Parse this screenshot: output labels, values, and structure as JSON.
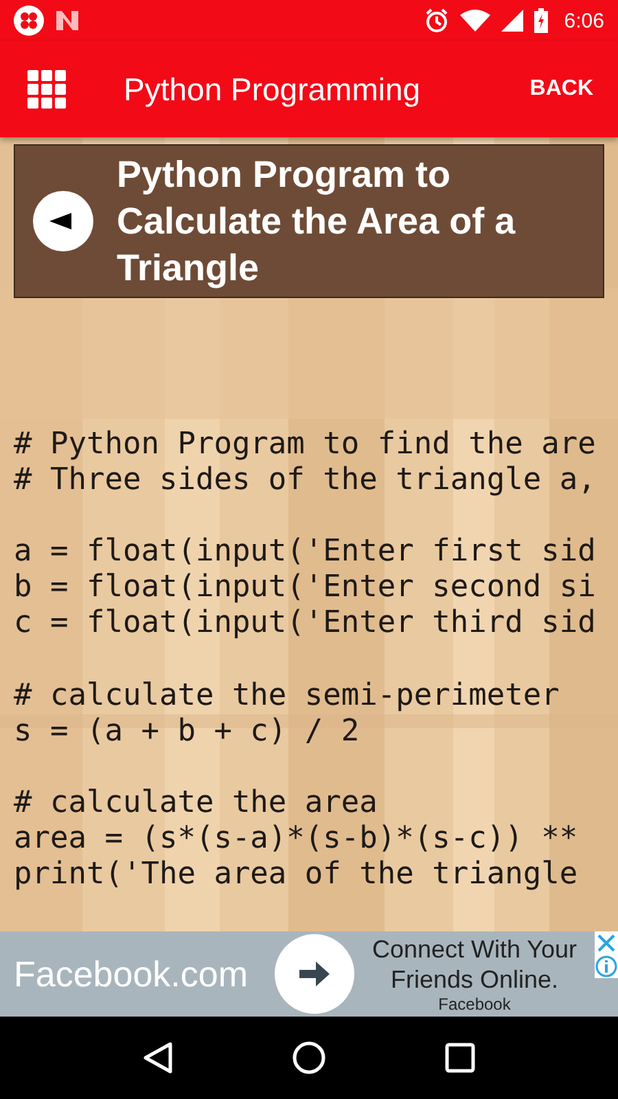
{
  "status_bar": {
    "time": "6:06"
  },
  "app_bar": {
    "title": "Python Programming",
    "back": "BACK"
  },
  "header": {
    "title": "Python Program to Calculate the Area of a Triangle"
  },
  "code_blocks": [
    [
      "# Python Program to find the are",
      "# Three sides of the triangle a,"
    ],
    [
      "a = float(input('Enter first sid",
      "b = float(input('Enter second si",
      "c = float(input('Enter third sid"
    ],
    [
      "# calculate the semi-perimeter",
      "s = (a + b + c) / 2"
    ],
    [
      "# calculate the area",
      "area = (s*(s-a)*(s-b)*(s-c)) **",
      "print('The area of the triangle"
    ]
  ],
  "ad": {
    "brand": "Facebook.com",
    "headline": "Connect With Your Friends Online.",
    "advertiser": "Facebook"
  }
}
